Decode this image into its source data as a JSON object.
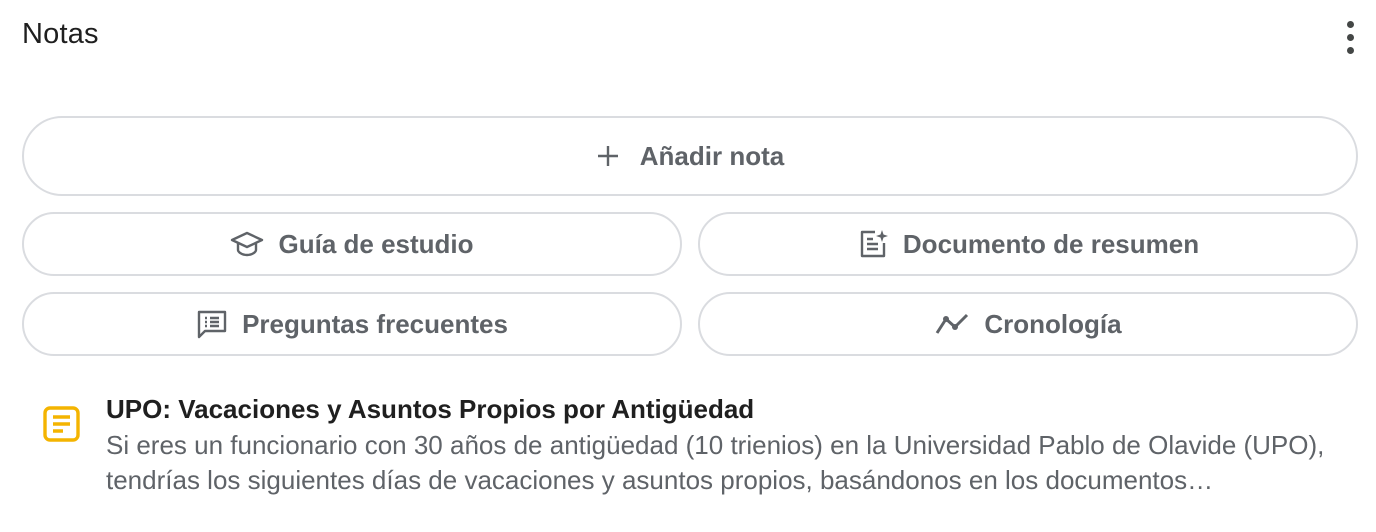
{
  "header": {
    "title": "Notas",
    "menu_icon": "more-vert-icon"
  },
  "actions": {
    "add_note": {
      "label": "Añadir nota",
      "icon": "plus-icon"
    },
    "study_guide": {
      "label": "Guía de estudio",
      "icon": "school-icon"
    },
    "summary_doc": {
      "label": "Documento de resumen",
      "icon": "summary-doc-icon"
    },
    "faq": {
      "label": "Preguntas frecuentes",
      "icon": "chat-list-icon"
    },
    "timeline": {
      "label": "Cronología",
      "icon": "timeline-icon"
    }
  },
  "notes": [
    {
      "icon": "note-icon",
      "title": "UPO: Vacaciones y Asuntos Propios por Antigüedad",
      "snippet": "Si eres un funcionario con 30 años de antigüedad (10 trienios) en la Universidad Pablo de Olavide (UPO), tendrías los siguientes días de vacaciones y asuntos propios, basándonos en los documentos proporcionados."
    }
  ],
  "colors": {
    "text": "#1f1f1f",
    "muted": "#5f6368",
    "border": "#dadce0",
    "note_icon": "#f4b400"
  }
}
